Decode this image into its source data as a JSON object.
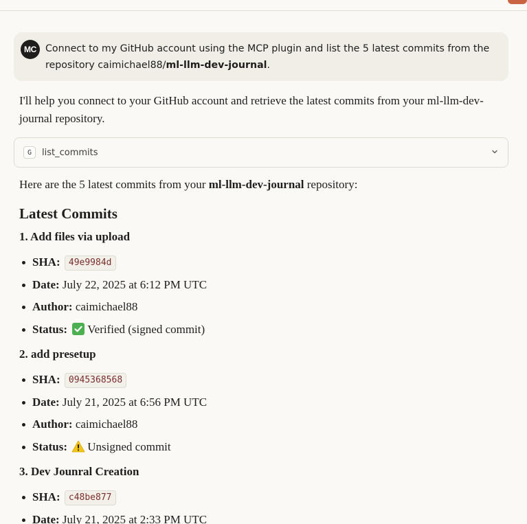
{
  "user_message": {
    "avatar_initials": "MC",
    "text_before": "Connect to my GitHub account using the MCP plugin and list the 5 latest commits from the repository caimichael88/",
    "repo_bold": "ml-llm-dev-journal",
    "text_after": "."
  },
  "assistant": {
    "intro_line": "I'll help you connect to your GitHub account and retrieve the latest commits from your ml-llm-dev-journal repository.",
    "tool_call": {
      "icon_letter": "G",
      "name": "list_commits"
    },
    "result_before": "Here are the 5 latest commits from your ",
    "result_repo": "ml-llm-dev-journal",
    "result_after": " repository:",
    "heading": "Latest Commits",
    "labels": {
      "sha": "SHA:",
      "date": "Date:",
      "author": "Author:",
      "status": "Status:"
    },
    "commits": [
      {
        "title": "1. Add files via upload",
        "sha": "49e9984d",
        "date": "July 22, 2025 at 6:12 PM UTC",
        "author": "caimichael88",
        "status_icon": "check-mark-icon",
        "status": "Verified (signed commit)"
      },
      {
        "title": "2. add presetup",
        "sha": "0945368568",
        "date": "July 21, 2025 at 6:56 PM UTC",
        "author": "caimichael88",
        "status_icon": "warning-icon",
        "status": "Unsigned commit"
      },
      {
        "title": "3. Dev Jounral Creation",
        "sha": "c48be877",
        "date": "July 21, 2025 at 2:33 PM UTC"
      }
    ]
  },
  "colors": {
    "background": "#faf9f5",
    "user_bubble": "#f0eee6",
    "accent": "#c96442",
    "check_green": "#4caf50",
    "warning_yellow": "#f5c518"
  }
}
